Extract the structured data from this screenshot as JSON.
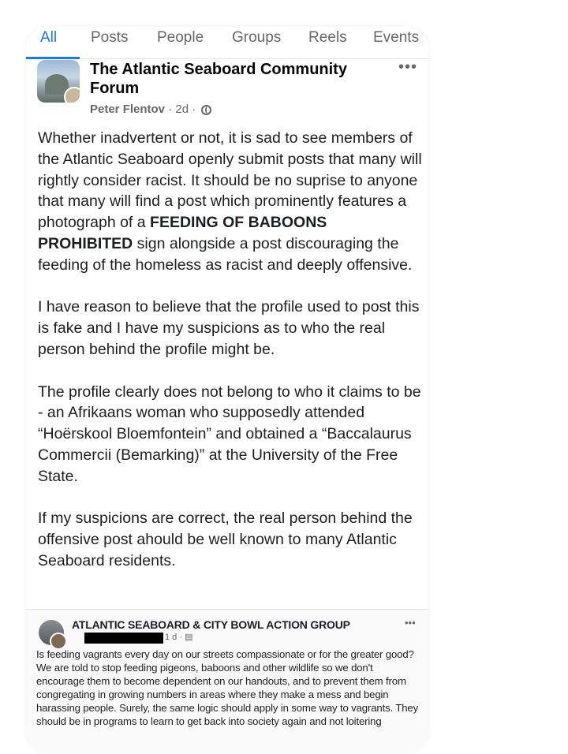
{
  "tabs": [
    {
      "label": "All",
      "active": true
    },
    {
      "label": "Posts",
      "active": false
    },
    {
      "label": "People",
      "active": false
    },
    {
      "label": "Groups",
      "active": false
    },
    {
      "label": "Reels",
      "active": false
    },
    {
      "label": "Events",
      "active": false
    }
  ],
  "post": {
    "group_name": "The Atlantic Seaboard Community Forum",
    "author": "Peter Flentov",
    "time": "2d",
    "separator": "·",
    "more": "•••",
    "paragraphs": [
      {
        "before": "Whether inadvertent or not, it is sad to see members of the Atlantic Seaboard openly submit posts that many will rightly consider racist.  It should be no suprise to anyone that many will find a post which prominently features a photograph of a ",
        "bold": "FEEDING OF BABOONS PROHIBITED",
        "after": " sign alongside a post discouraging the feeding of the homeless as racist and deeply offensive."
      },
      {
        "text": "I have reason to believe that the profile used to post this is fake and I have my suspicions as to who the real person behind the profile might be."
      },
      {
        "text": "The profile clearly does not belong to who it claims to be - an Afrikaans woman who supposedly attended “Hoërskool Bloemfontein” and obtained a “Baccalaurus Commercii (Bemarking)” at the University of the Free State."
      },
      {
        "text": "If my suspicions are correct, the real person behind the offensive post ahould be well known to many Atlantic Seaboard residents."
      }
    ]
  },
  "shared_post": {
    "group_name": "ATLANTIC SEABOARD & CITY BOWL ACTION GROUP",
    "time": "1 d · ",
    "more": "•••",
    "text": "Is feeding vagrants every day on our streets compassionate or for the greater good? We are told to stop feeding pigeons, baboons and other wildlife so we don't encourage them to become dependent on our handouts, and to prevent them from congregating in growing numbers in areas where they make a mess and begin harassing people. Surely, the same logic should apply in some way to vagrants. They should be in programs to learn to get back into society again and not loitering"
  },
  "colors": {
    "accent": "#1877f2",
    "secondary_text": "#65676b",
    "primary_text": "#1c1e21"
  }
}
